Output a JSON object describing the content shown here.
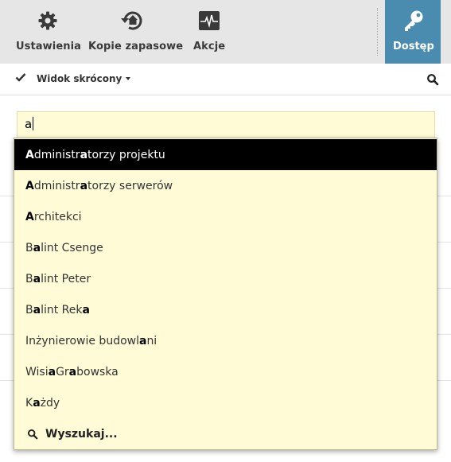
{
  "toolbar": {
    "settings_label": "Ustawienia",
    "backups_label": "Kopie zapasowe",
    "actions_label": "Akcje",
    "access_label": "Dostęp"
  },
  "subbar": {
    "view_label": "Widok skrócony"
  },
  "search": {
    "value": "a"
  },
  "suggestions": [
    {
      "pre": "",
      "hl1": "A",
      "mid": "dministr",
      "hl2": "a",
      "post": "torzy projektu"
    },
    {
      "pre": "",
      "hl1": "A",
      "mid": "dministr",
      "hl2": "a",
      "post": "torzy serwerów"
    },
    {
      "pre": "",
      "hl1": "A",
      "mid": "rchitekci",
      "hl2": "",
      "post": ""
    },
    {
      "pre": "B",
      "hl1": "a",
      "mid": "lint Csenge",
      "hl2": "",
      "post": ""
    },
    {
      "pre": "B",
      "hl1": "a",
      "mid": "lint Peter",
      "hl2": "",
      "post": ""
    },
    {
      "pre": "B",
      "hl1": "a",
      "mid": "lint Rek",
      "hl2": "a",
      "post": ""
    },
    {
      "pre": "Inżynierowie budowl",
      "hl1": "a",
      "mid": "ni",
      "hl2": "",
      "post": ""
    },
    {
      "pre": "Wisi",
      "hl1": "a",
      "mid": " Gr",
      "hl2": "a",
      "post": "bowska"
    },
    {
      "pre": "K",
      "hl1": "a",
      "mid": "żdy",
      "hl2": "",
      "post": ""
    }
  ],
  "search_more_label": "Wyszukaj...",
  "colors": {
    "toolbar_bg": "#e6e6e6",
    "accent": "#4a8bb0",
    "dropdown_bg": "#fefbd6",
    "highlight_bg": "#000000"
  }
}
